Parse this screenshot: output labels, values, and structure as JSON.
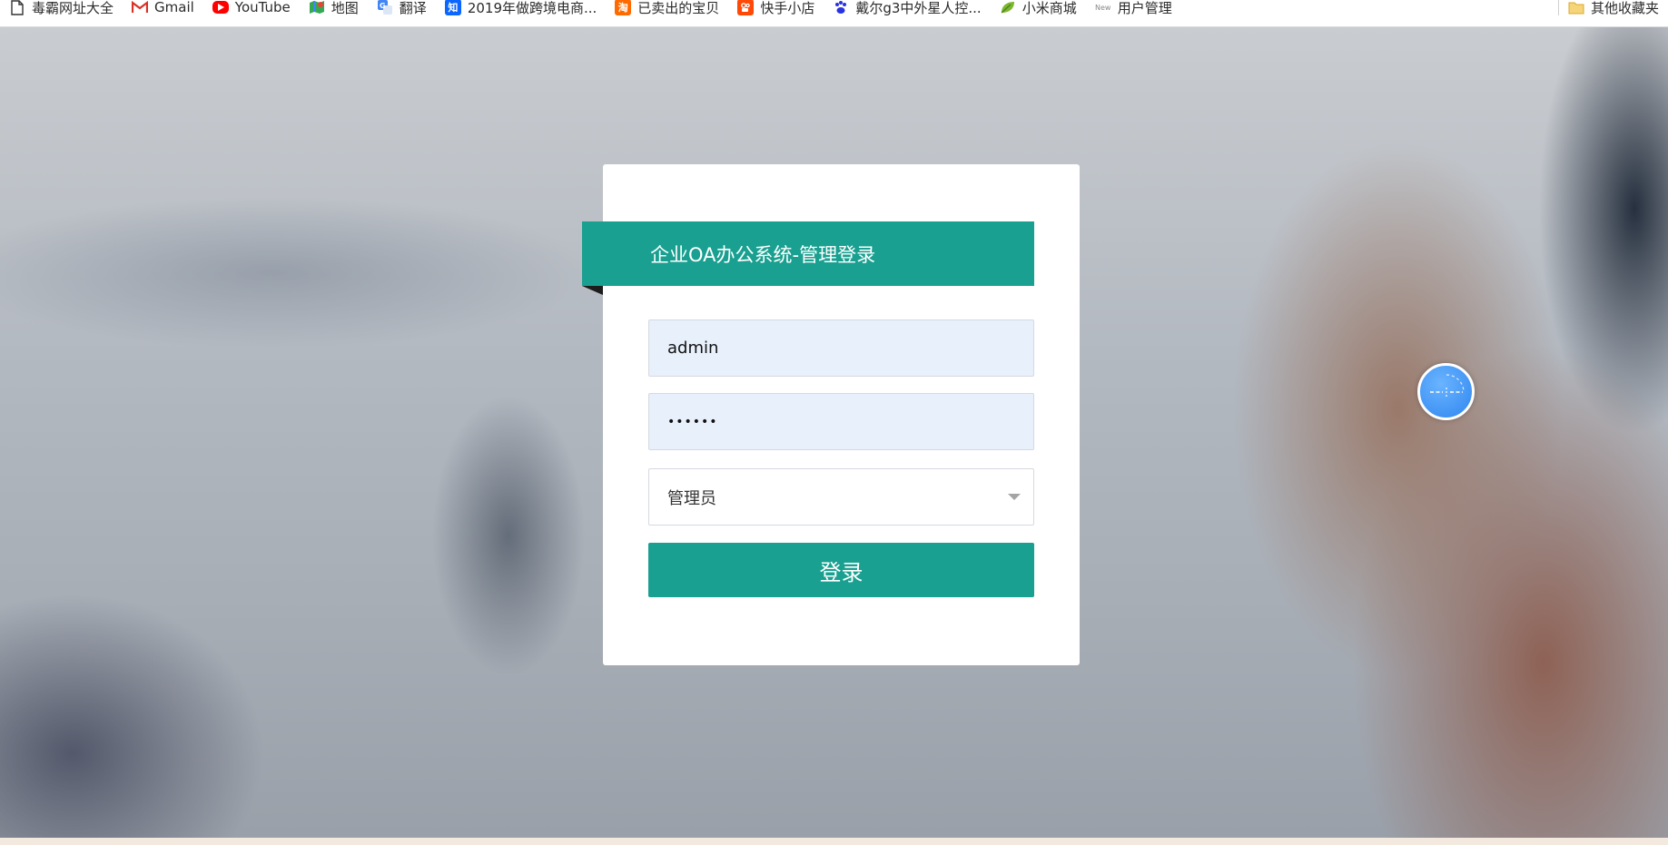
{
  "bookmarks": [
    {
      "label": "毒霸网址大全",
      "icon": "file-icon"
    },
    {
      "label": "Gmail",
      "icon": "gmail-icon"
    },
    {
      "label": "YouTube",
      "icon": "youtube-icon"
    },
    {
      "label": "地图",
      "icon": "maps-icon"
    },
    {
      "label": "翻译",
      "icon": "translate-icon"
    },
    {
      "label": "2019年做跨境电商...",
      "icon": "zhihu-icon",
      "icon_text": "知"
    },
    {
      "label": "已卖出的宝贝",
      "icon": "taobao-icon",
      "icon_text": "淘"
    },
    {
      "label": "快手小店",
      "icon": "kuaishou-icon"
    },
    {
      "label": "戴尔g3中外星人控...",
      "icon": "baidu-icon"
    },
    {
      "label": "小米商城",
      "icon": "leaf-icon"
    },
    {
      "label": "用户管理",
      "icon": "new-icon",
      "icon_text": "New"
    },
    {
      "label": "其他收藏夹",
      "icon": "folder-icon"
    }
  ],
  "login": {
    "title": "企业OA办公系统-管理登录",
    "username": "admin",
    "password": "••••••",
    "role": "管理员",
    "submit_label": "登录"
  },
  "colors": {
    "accent": "#19a090",
    "input_bg": "#e8f0fc",
    "widget": "#2f86f0"
  }
}
